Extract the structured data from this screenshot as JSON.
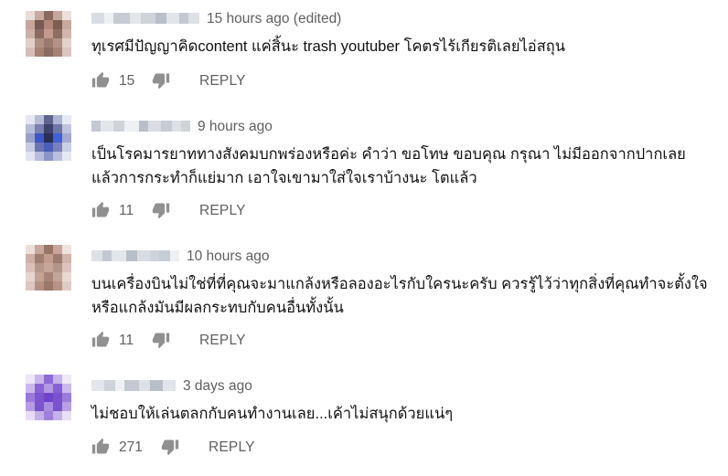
{
  "colors": {
    "secondary_text": "#606060",
    "primary_text": "#111111",
    "background": "#ffffff"
  },
  "icons": [
    "thumb-up-icon",
    "thumb-down-icon"
  ],
  "comments": [
    {
      "timestamp": "15 hours ago (edited)",
      "text_lines": [
        "ทุเรศมีปัญญาคิดcontent แค่สิ้นะ trash youtuber โคตรไร้เกียรติเลยไอ่สถุน"
      ],
      "likes": "15",
      "reply_label": "REPLY"
    },
    {
      "timestamp": "9 hours ago",
      "text_lines": [
        "เป็นโรคมารยาททางสังคมบกพร่องหรือค่ะ คำว่า ขอโทษ ขอบคุณ กรุณา ไม่มีออกจากปากเลย",
        "แล้วการกระทำก็แย่มาก เอาใจเขามาใส่ใจเราบ้างนะ โตแล้ว"
      ],
      "likes": "11",
      "reply_label": "REPLY"
    },
    {
      "timestamp": "10 hours ago",
      "text_lines": [
        "บนเครื่องบินไม่ใช่ที่ที่คุณจะมาแกล้งหรือลองอะไรกับใครนะครับ ควรรู้ไว้ว่าทุกสิ่งที่คุณทำจะตั้งใจ",
        "หรือแกล้งมันมีผลกระทบกับคนอื่นทั้งนั้น"
      ],
      "likes": "11",
      "reply_label": "REPLY"
    },
    {
      "timestamp": "3 days ago",
      "text_lines": [
        "ไม่ชอบให้เล่นตลกกับคนทำงานเลย...เค้าไม่สนุกด้วยแน่ๆ"
      ],
      "likes": "271",
      "reply_label": "REPLY"
    }
  ]
}
